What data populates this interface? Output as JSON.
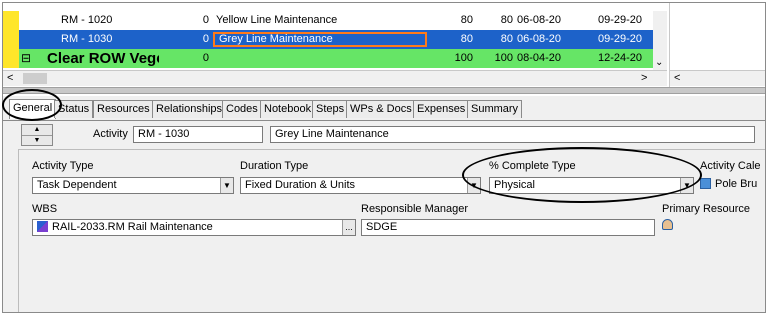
{
  "grid": {
    "rows": [
      {
        "id": "RM - 1020",
        "pct": "0",
        "name": "Yellow Line Maintenance",
        "orig_dur": "80",
        "rem_dur": "80",
        "start": "06-08-20",
        "finish": "09-29-20"
      },
      {
        "id": "RM - 1030",
        "pct": "0",
        "name": "Grey Line Maintenance",
        "orig_dur": "80",
        "rem_dur": "80",
        "start": "06-08-20",
        "finish": "09-29-20"
      },
      {
        "id": "Clear ROW Vege",
        "pct": "0",
        "name": "",
        "orig_dur": "100",
        "rem_dur": "100",
        "start": "08-04-20",
        "finish": "12-24-20",
        "expand": "⊟"
      }
    ],
    "scroll_left": "<",
    "scroll_right": ">",
    "scroll_down": "⌄"
  },
  "tabs": [
    "General",
    "Status",
    "Resources",
    "Relationships",
    "Codes",
    "Notebook",
    "Steps",
    "WPs & Docs",
    "Expenses",
    "Summary"
  ],
  "detail": {
    "activity_label": "Activity",
    "activity_id": "RM - 1030",
    "activity_name": "Grey Line Maintenance",
    "activity_type_label": "Activity Type",
    "activity_type_value": "Task Dependent",
    "duration_type_label": "Duration Type",
    "duration_type_value": "Fixed Duration & Units",
    "pct_type_label": "% Complete Type",
    "pct_type_value": "Physical",
    "calendar_label": "Activity Cale",
    "calendar_value": "Pole Bru",
    "wbs_label": "WBS",
    "wbs_value": "RAIL-2033.RM  Rail Maintenance",
    "wbs_btn": "...",
    "manager_label": "Responsible Manager",
    "manager_value": "SDGE",
    "resource_label": "Primary Resource"
  },
  "colors": {
    "selected_row": "#1d62c9",
    "wbs_row": "#66e566",
    "edit_border": "#ff7a1a"
  }
}
